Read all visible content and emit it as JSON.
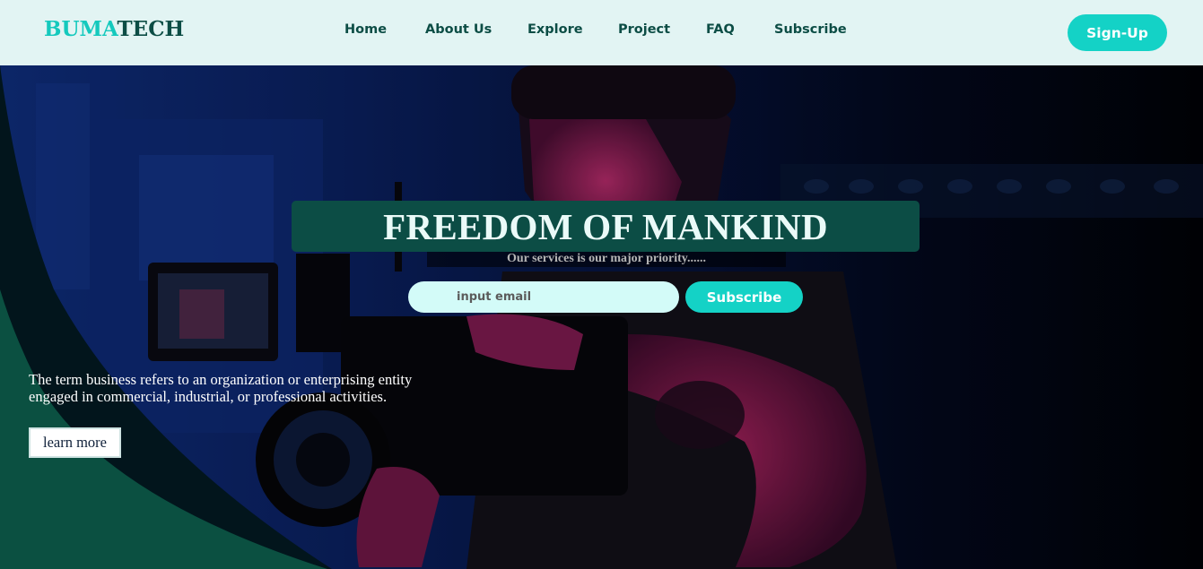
{
  "brand": {
    "part1": "BUMA",
    "part2": "TECH",
    "accent_color": "#14c9bd",
    "dark_color": "#0c4d45"
  },
  "nav": {
    "items": [
      {
        "label": "Home"
      },
      {
        "label": "About Us"
      },
      {
        "label": "Explore"
      },
      {
        "label": "Project"
      },
      {
        "label": "FAQ"
      },
      {
        "label": "Subscribe"
      }
    ],
    "signup_label": "Sign-Up"
  },
  "hero": {
    "title": "FREEDOM OF MANKIND",
    "tagline": "Our services is our major priority......",
    "email_placeholder": "input email",
    "subscribe_label": "Subscribe",
    "description": "The term business refers to an organization or enterprising entity engaged in commercial, industrial, or professional activities.",
    "learn_more_label": "learn more",
    "background_image": "videographer-with-camera-photo"
  },
  "colors": {
    "nav_bg": "#e2f4f3",
    "button_teal": "#14d2c6",
    "headline_box": "#0c4d45",
    "input_bg": "#d3fbf8"
  }
}
